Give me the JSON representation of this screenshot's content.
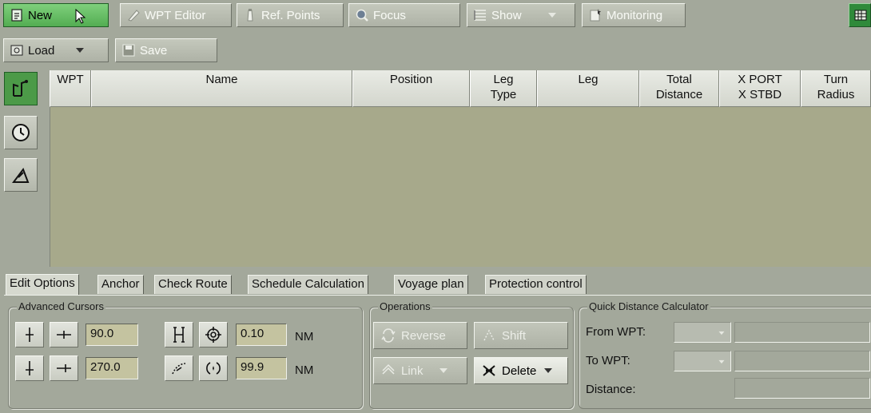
{
  "toolbar": {
    "new_label": "New",
    "wpt_editor_label": "WPT Editor",
    "ref_points_label": "Ref. Points",
    "focus_label": "Focus",
    "show_label": "Show",
    "monitoring_label": "Monitoring",
    "load_label": "Load",
    "save_label": "Save"
  },
  "table": {
    "columns": [
      {
        "line1": "WPT",
        "line2": ""
      },
      {
        "line1": "Name",
        "line2": ""
      },
      {
        "line1": "Position",
        "line2": ""
      },
      {
        "line1": "Leg",
        "line2": "Type"
      },
      {
        "line1": "Leg",
        "line2": ""
      },
      {
        "line1": "Total",
        "line2": "Distance"
      },
      {
        "line1": "X PORT",
        "line2": "X STBD"
      },
      {
        "line1": "Turn",
        "line2": "Radius"
      }
    ],
    "rows": []
  },
  "sidebar": {
    "items": [
      {
        "icon": "route-waypoints-icon",
        "active": true
      },
      {
        "icon": "clock-icon",
        "active": false
      },
      {
        "icon": "ruler-angle-icon",
        "active": false
      }
    ]
  },
  "tabs": [
    "Edit Options",
    "Anchor",
    "Check Route",
    "Schedule Calculation",
    "Voyage plan",
    "Protection control"
  ],
  "active_tab": "Edit Options",
  "advanced_cursors": {
    "legend": "Advanced Cursors",
    "value1": "90.0",
    "value2": "270.0",
    "value3": "0.10",
    "value4": "99.9",
    "unit": "NM"
  },
  "operations": {
    "legend": "Operations",
    "reverse_label": "Reverse",
    "shift_label": "Shift",
    "link_label": "Link",
    "delete_label": "Delete"
  },
  "quick_distance": {
    "legend": "Quick Distance Calculator",
    "from_label": "From WPT:",
    "to_label": "To WPT:",
    "distance_label": "Distance:"
  },
  "colors": {
    "active_green": "#4c9a48",
    "table_bg": "#a7a98b",
    "value_bg": "#c4c3a0"
  }
}
